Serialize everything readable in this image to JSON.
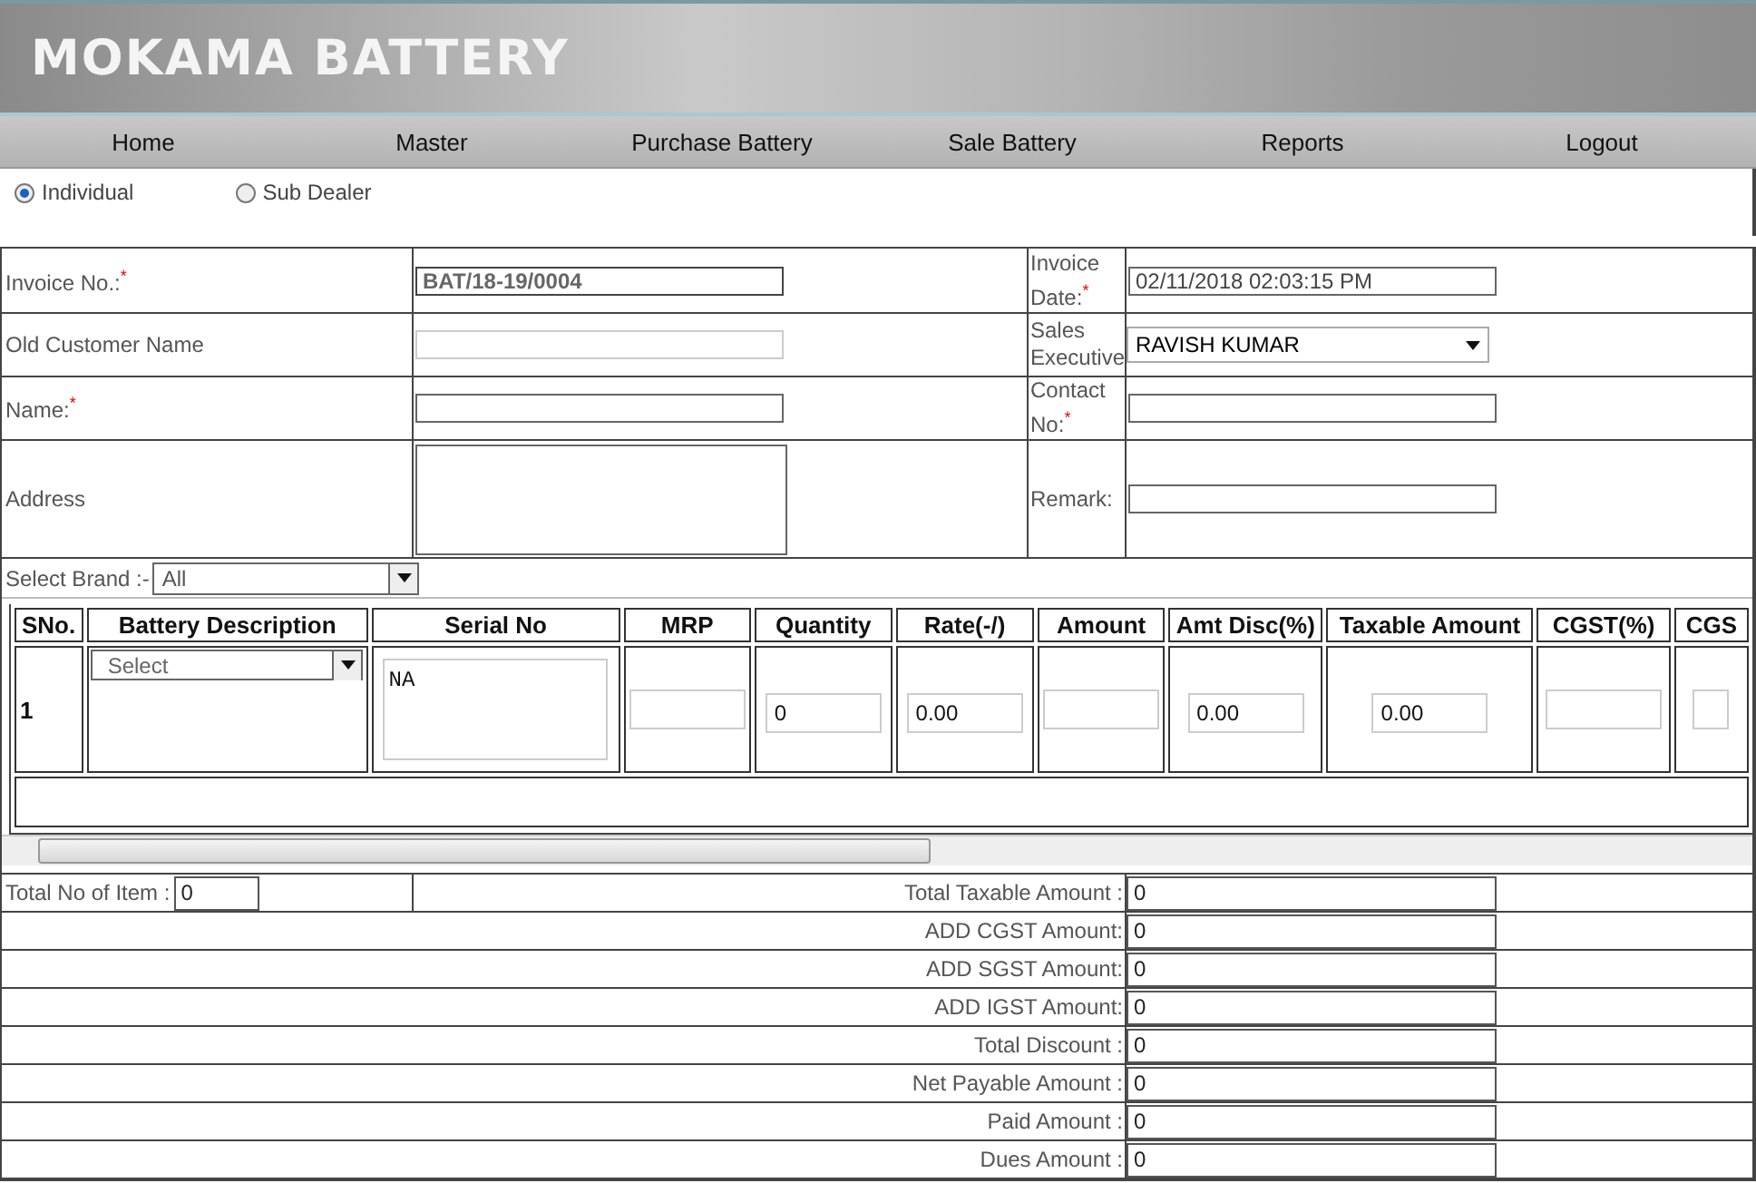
{
  "header": {
    "title": "MOKAMA BATTERY"
  },
  "nav": [
    {
      "label": "Home"
    },
    {
      "label": "Master"
    },
    {
      "label": "Purchase Battery"
    },
    {
      "label": "Sale Battery"
    },
    {
      "label": "Reports"
    },
    {
      "label": "Logout"
    }
  ],
  "customer_types": [
    {
      "label": "Individual",
      "selected": true
    },
    {
      "label": "Sub Dealer",
      "selected": false
    }
  ],
  "form_rows": [
    {
      "left": {
        "label": "Invoice No.:$^{*}$",
        "kind": "input",
        "value": "BAT/18-19/0004"
      },
      "right": {
        "label": "Invoice Date:$^{*}$",
        "kind": "input",
        "value": "02/11/2018 02:03:15 PM"
      }
    },
    {
      "left": {
        "label": "Old Customer Name",
        "kind": "input"
      },
      "right": {
        "label": "Sales Executive",
        "kind": "select",
        "value": "RAVISH KUMAR"
      }
    },
    {
      "left": {
        "label": "Name:$^{*}$",
        "kind": "input"
      },
      "right": {
        "label": "Contact No:$^{*}$",
        "kind": "input"
      }
    },
    {
      "left": {
        "label": "Address",
        "kind": "textarea"
      },
      "right": {
        "label": "Remark:",
        "kind": "input"
      }
    }
  ],
  "brand": {
    "label": "Select Brand :-",
    "value": "All"
  },
  "items": {
    "columns": [
      "SNo.",
      "Battery Description",
      "Serial No",
      "MRP",
      "Quantity",
      "Rate(-/)",
      "Amount",
      "Amt Disc(%)",
      "Taxable Amount",
      "CGST(%)",
      "CGS"
    ],
    "rows": [
      {
        "cells": [
          {
            "kind": "text",
            "value": "1"
          },
          {
            "kind": "select",
            "value": "Select"
          },
          {
            "kind": "textarea",
            "value": "NA"
          },
          {
            "kind": "input"
          },
          {
            "kind": "input",
            "value": "0"
          },
          {
            "kind": "input",
            "value": "0.00"
          },
          {
            "kind": "input"
          },
          {
            "kind": "input",
            "value": "0.00"
          },
          {
            "kind": "input",
            "value": "0.00"
          },
          {
            "kind": "input"
          },
          {
            "kind": "input"
          }
        ]
      }
    ]
  },
  "totals": {
    "item_count": {
      "label": "Total No of Item :",
      "value": "0"
    },
    "rows": [
      {
        "label": "Total Taxable Amount :",
        "value": "0"
      },
      {
        "label": "ADD CGST Amount:",
        "value": "0"
      },
      {
        "label": "ADD SGST Amount:",
        "value": "0"
      },
      {
        "label": "ADD IGST Amount:",
        "value": "0"
      },
      {
        "label": "Total Discount :",
        "value": "0"
      },
      {
        "label": "Net Payable Amount :",
        "value": "0"
      },
      {
        "label": "Paid Amount :",
        "value": "0"
      },
      {
        "label": "Dues Amount :",
        "value": "0"
      }
    ]
  }
}
